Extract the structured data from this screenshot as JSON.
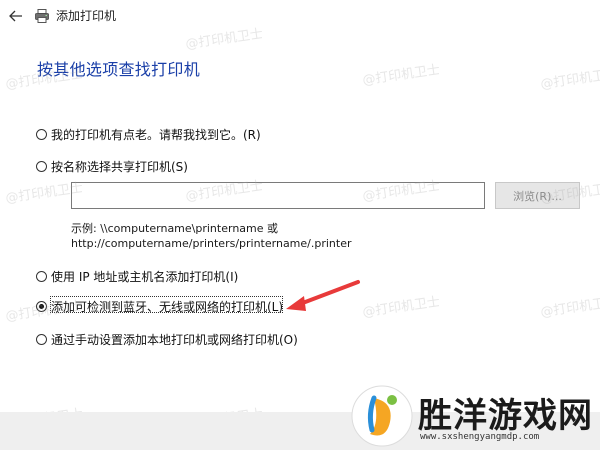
{
  "window": {
    "title": "添加打印机",
    "back_icon": "back-arrow-icon",
    "printer_icon": "printer-icon"
  },
  "main": {
    "heading": "按其他选项查找打印机",
    "options": [
      {
        "label": "我的打印机有点老。请帮我找到它。(R)",
        "checked": false
      },
      {
        "label": "按名称选择共享打印机(S)",
        "checked": false
      },
      {
        "label": "使用 IP 地址或主机名添加打印机(I)",
        "checked": false
      },
      {
        "label": "添加可检测到蓝牙、无线或网络的打印机(L)",
        "checked": true
      },
      {
        "label": "通过手动设置添加本地打印机或网络打印机(O)",
        "checked": false
      }
    ],
    "name_input_value": "",
    "browse_label": "浏览(R)...",
    "example_line1": "示例: \\\\computername\\printername 或",
    "example_line2": "http://computername/printers/printername/.printer"
  },
  "annotation": {
    "arrow_color": "#e83a3a"
  },
  "watermark": {
    "text": "@打印机卫士"
  },
  "logo": {
    "text": "胜洋游戏网",
    "url": "www.sxshengyangmdp.com"
  },
  "colors": {
    "heading": "#1a3fa8",
    "arrow": "#e83a3a",
    "bottom_bar": "#efefef"
  }
}
